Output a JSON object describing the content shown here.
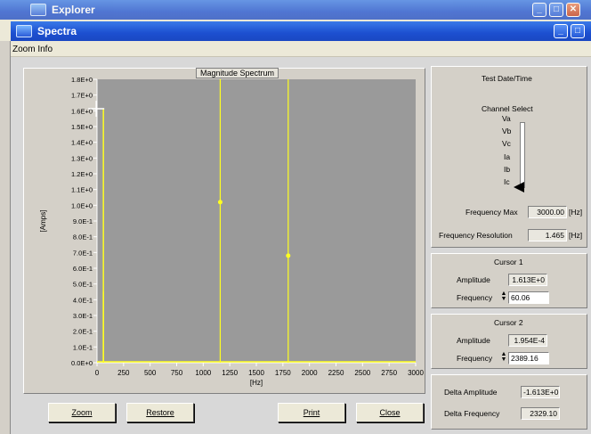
{
  "outer_window": {
    "title": "Explorer"
  },
  "window": {
    "title": "Spectra"
  },
  "menu": {
    "item": "Zoom Info"
  },
  "plot": {
    "title": "Magnitude Spectrum",
    "ylabel": "[Amps]",
    "xlabel": "[Hz]",
    "y_ticks": [
      "1.8E+0",
      "1.7E+0",
      "1.6E+0",
      "1.5E+0",
      "1.4E+0",
      "1.3E+0",
      "1.2E+0",
      "1.1E+0",
      "1.0E+0",
      "9.0E-1",
      "8.0E-1",
      "7.0E-1",
      "6.0E-1",
      "5.0E-1",
      "4.0E-1",
      "3.0E-1",
      "2.0E-1",
      "1.0E-1",
      "0.0E+0"
    ],
    "x_ticks": [
      "0",
      "250",
      "500",
      "750",
      "1000",
      "1250",
      "1500",
      "1750",
      "2000",
      "2250",
      "2500",
      "2750",
      "3000"
    ],
    "colors": {
      "background": "#9a9a9a",
      "trace": "#ffff20",
      "axis": "#ffffff"
    }
  },
  "chart_data": {
    "type": "line",
    "title": "Magnitude Spectrum",
    "xlabel": "[Hz]",
    "ylabel": "[Amps]",
    "xlim": [
      0,
      3000
    ],
    "ylim": [
      0,
      1.8
    ],
    "series": [
      {
        "x": [
          60.06,
          60.06,
          120,
          180,
          1200,
          1800,
          2400,
          3000
        ],
        "y": [
          1.613,
          0.45,
          0.0,
          0.0,
          0.0,
          0.0,
          0.0,
          0.0
        ]
      }
    ],
    "cursors": [
      {
        "x": 1160,
        "y": 1.02
      },
      {
        "x": 1800,
        "y": 0.68
      }
    ]
  },
  "right": {
    "test_date_label": "Test Date/Time",
    "channel_select_label": "Channel Select",
    "channels": [
      "Va",
      "Vb",
      "Vc",
      "Ia",
      "Ib",
      "Ic"
    ],
    "freq_max_label": "Frequency Max",
    "freq_max_value": "3000.00",
    "freq_max_unit": "[Hz]",
    "freq_res_label": "Frequency Resolution",
    "freq_res_value": "1.465",
    "freq_res_unit": "[Hz]"
  },
  "cursor1": {
    "title": "Cursor 1",
    "amplitude_label": "Amplitude",
    "amplitude": "1.613E+0",
    "frequency_label": "Frequency",
    "frequency": "60.06"
  },
  "cursor2": {
    "title": "Cursor 2",
    "amplitude_label": "Amplitude",
    "amplitude": "1.954E-4",
    "frequency_label": "Frequency",
    "frequency": "2389.16"
  },
  "delta": {
    "amplitude_label": "Delta Amplitude",
    "amplitude": "-1.613E+0",
    "frequency_label": "Delta Frequency",
    "frequency": "2329.10"
  },
  "buttons": {
    "zoom": "Zoom",
    "restore": "Restore",
    "print": "Print",
    "close": "Close"
  }
}
